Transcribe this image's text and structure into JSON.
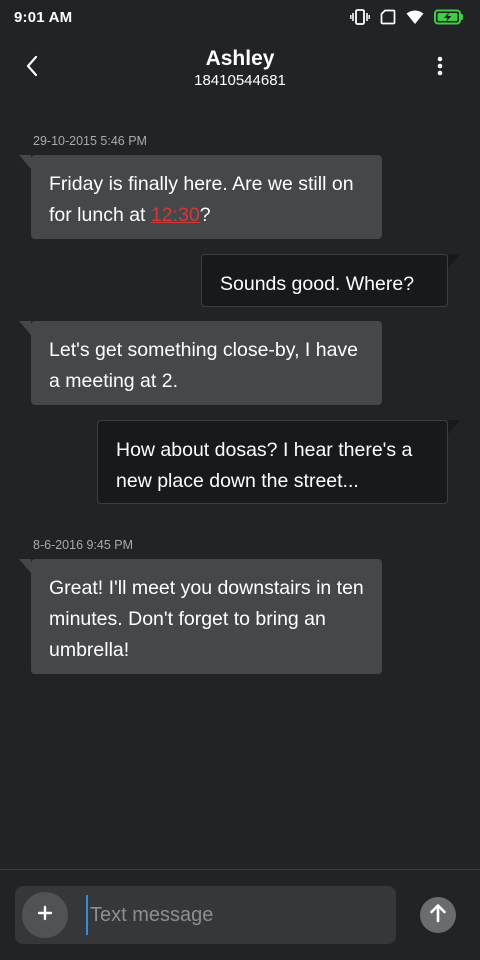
{
  "status_bar": {
    "time": "9:01 AM",
    "icons": [
      "vibrate-icon",
      "no-sim-icon",
      "wifi-icon",
      "battery-charging-icon"
    ],
    "battery_color": "#3bd140"
  },
  "header": {
    "contact_name": "Ashley",
    "contact_number": "18410544681",
    "back_icon": "chevron-left-icon",
    "menu_icon": "more-vertical-icon"
  },
  "messages": [
    {
      "type": "timestamp",
      "text": "29-10-2015 5:46 PM"
    },
    {
      "type": "incoming",
      "text_before": "Friday is finally here. Are we still on for lunch at ",
      "link": "12:30",
      "text_after": "?"
    },
    {
      "type": "outgoing",
      "text": "Sounds good. Where?"
    },
    {
      "type": "incoming",
      "text": "Let's get something close-by, I have a meeting at 2."
    },
    {
      "type": "outgoing",
      "text": "How about dosas? I hear there's a new place down the street..."
    },
    {
      "type": "timestamp",
      "text": "8-6-2016 9:45 PM"
    },
    {
      "type": "incoming",
      "text": "Great! I'll meet you downstairs in ten minutes. Don't forget to bring an umbrella!"
    }
  ],
  "composer": {
    "placeholder": "Text message",
    "value": "",
    "add_icon": "plus-icon",
    "send_icon": "arrow-up-icon"
  },
  "colors": {
    "background": "#222326",
    "incoming_bubble": "#45474b",
    "outgoing_bubble": "#18191b",
    "link": "#d23a37",
    "cursor": "#2f8fd8"
  }
}
